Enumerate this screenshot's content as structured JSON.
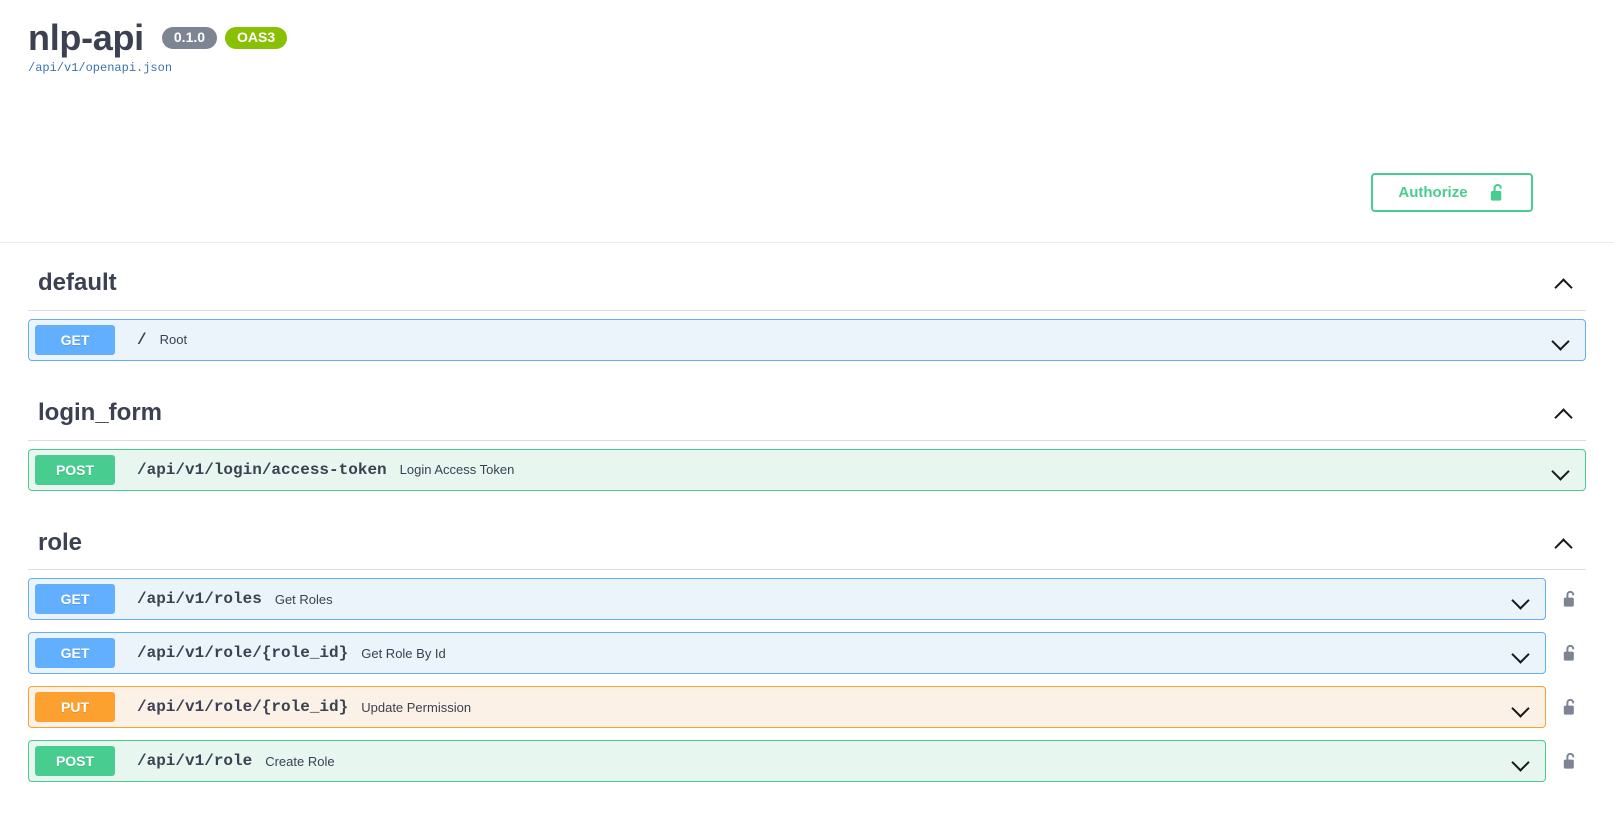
{
  "header": {
    "title": "nlp-api",
    "version_badge": "0.1.0",
    "spec_badge": "OAS3",
    "spec_url": "/api/v1/openapi.json",
    "authorize_label": "Authorize",
    "authorize_icon": "unlock-icon",
    "accent_green": "#49cc90",
    "badge_gray": "#7d8492",
    "badge_green": "#89bf04",
    "link_blue": "#3b74ad"
  },
  "method_colors": {
    "get": "#61affe",
    "post": "#49cc90",
    "put": "#fca130",
    "delete": "#f93e3e"
  },
  "sections": [
    {
      "tag": "default",
      "expanded": true,
      "toggle_icon": "chevron-up-icon",
      "operations": [
        {
          "method": "GET",
          "method_class": "get",
          "path": "/",
          "summary": "Root",
          "locked": false,
          "expand_icon": "chevron-down-icon"
        }
      ]
    },
    {
      "tag": "login_form",
      "expanded": true,
      "toggle_icon": "chevron-up-icon",
      "operations": [
        {
          "method": "POST",
          "method_class": "post",
          "path": "/api/v1/login/access-token",
          "summary": "Login Access Token",
          "locked": false,
          "expand_icon": "chevron-down-icon"
        }
      ]
    },
    {
      "tag": "role",
      "expanded": true,
      "toggle_icon": "chevron-up-icon",
      "operations": [
        {
          "method": "GET",
          "method_class": "get",
          "path": "/api/v1/roles",
          "summary": "Get Roles",
          "locked": true,
          "lock_icon": "unlock-icon",
          "expand_icon": "chevron-down-icon"
        },
        {
          "method": "GET",
          "method_class": "get",
          "path": "/api/v1/role/{role_id}",
          "summary": "Get Role By Id",
          "locked": true,
          "lock_icon": "unlock-icon",
          "expand_icon": "chevron-down-icon"
        },
        {
          "method": "PUT",
          "method_class": "put",
          "path": "/api/v1/role/{role_id}",
          "summary": "Update Permission",
          "locked": true,
          "lock_icon": "unlock-icon",
          "expand_icon": "chevron-down-icon"
        },
        {
          "method": "POST",
          "method_class": "post",
          "path": "/api/v1/role",
          "summary": "Create Role",
          "locked": true,
          "lock_icon": "unlock-icon",
          "expand_icon": "chevron-down-icon"
        }
      ]
    }
  ]
}
